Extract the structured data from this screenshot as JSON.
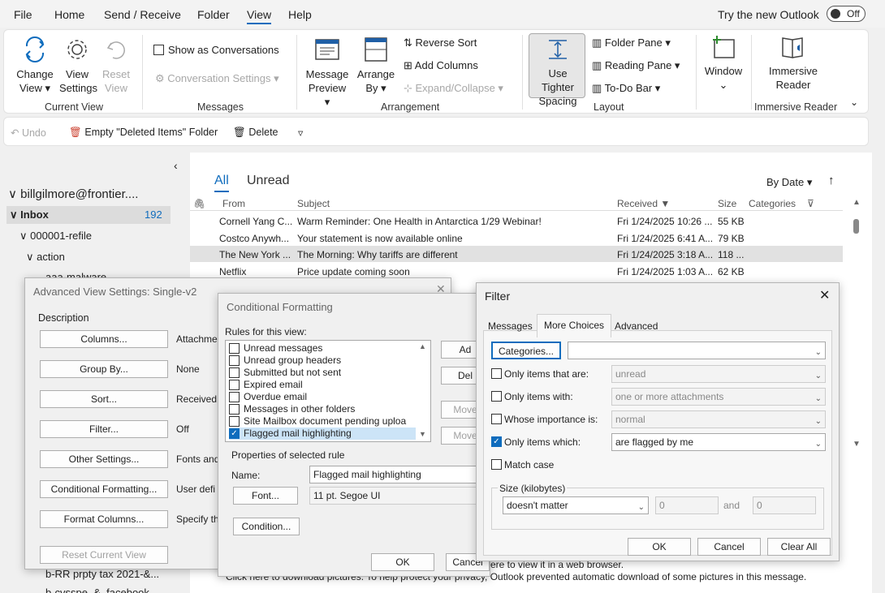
{
  "menu": {
    "items": [
      "File",
      "Home",
      "Send / Receive",
      "Folder",
      "View",
      "Help"
    ],
    "try_new": "Try the new Outlook",
    "toggle_label": "Off"
  },
  "ribbon": {
    "change_view": "Change View ▾",
    "view_settings": "View Settings",
    "reset_view": "Reset View",
    "current_view_label": "Current View",
    "show_as_conversations": "Show as Conversations",
    "conversation_settings": "Conversation Settings ▾",
    "messages_label": "Messages",
    "message_preview": "Message Preview ▾",
    "arrange_by": "Arrange By ▾",
    "reverse_sort": "Reverse Sort",
    "add_columns": "Add Columns",
    "expand_collapse": "Expand/Collapse ▾",
    "arrangement_label": "Arrangement",
    "use_tighter_spacing": "Use Tighter Spacing",
    "folder_pane": "Folder Pane ▾",
    "reading_pane": "Reading Pane ▾",
    "todo_bar": "To-Do Bar ▾",
    "layout_label": "Layout",
    "window": "Window",
    "immersive_reader": "Immersive Reader",
    "immersive_reader_label": "Immersive Reader"
  },
  "qat": {
    "undo": "Undo",
    "empty_deleted": "Empty \"Deleted Items\" Folder",
    "delete": "Delete"
  },
  "folders": {
    "account": "billgilmore@frontier....",
    "inbox": "Inbox",
    "inbox_count": "192",
    "refile": "000001-refile",
    "action": "action",
    "aaa_malware": "aaa-malware",
    "bottom1": "b-RR prpty tax 2021-&...",
    "bottom2": "b-cvsspe_&_facebook"
  },
  "list": {
    "tab_all": "All",
    "tab_unread": "Unread",
    "sort": "By Date ▾",
    "columns": [
      "From",
      "Subject",
      "Received ▼",
      "Size",
      "Categories"
    ],
    "rows": [
      {
        "from": "Cornell Yang C...",
        "subject": "Warm Reminder: One Health in Antarctica 1/29 Webinar!",
        "received": "Fri 1/24/2025 10:26 ...",
        "size": "55 KB"
      },
      {
        "from": "Costco Anywh...",
        "subject": "Your statement is now available online",
        "received": "Fri 1/24/2025 6:41 A...",
        "size": "79 KB"
      },
      {
        "from": "The New York ...",
        "subject": "The Morning: Why tariffs are different",
        "received": "Fri 1/24/2025 3:18 A...",
        "size": "118 ..."
      },
      {
        "from": "Netflix",
        "subject": "Price update coming soon",
        "received": "Fri 1/24/2025 1:03 A...",
        "size": "62 KB"
      }
    ],
    "reading_line1": "ere to view it in a web browser.",
    "reading_line2": "Click here to download pictures. To help protect your privacy, Outlook prevented automatic download of some pictures in this message."
  },
  "adv": {
    "title": "Advanced View Settings: Single-v2",
    "description": "Description",
    "buttons": [
      "Columns...",
      "Group By...",
      "Sort...",
      "Filter...",
      "Other Settings...",
      "Conditional Formatting...",
      "Format Columns..."
    ],
    "values": [
      "Attachme",
      "None",
      "Received",
      "Off",
      "Fonts and",
      "User defi",
      "Specify th"
    ],
    "reset": "Reset Current View"
  },
  "cf": {
    "title": "Conditional Formatting",
    "rules_label": "Rules for this view:",
    "rules": [
      {
        "label": "Unread messages",
        "checked": false
      },
      {
        "label": "Unread group headers",
        "checked": false
      },
      {
        "label": "Submitted but not sent",
        "checked": false
      },
      {
        "label": "Expired email",
        "checked": false
      },
      {
        "label": "Overdue email",
        "checked": false
      },
      {
        "label": "Messages in other folders",
        "checked": false
      },
      {
        "label": "Site Mailbox document pending uploa",
        "checked": false
      },
      {
        "label": "Flagged mail highlighting",
        "checked": true
      }
    ],
    "side_buttons": [
      "Ad",
      "Del",
      "Move",
      "Move"
    ],
    "props_label": "Properties of selected rule",
    "name_label": "Name:",
    "name_value": "Flagged mail highlighting",
    "font_btn": "Font...",
    "font_value": "11 pt. Segoe UI",
    "condition_btn": "Condition...",
    "ok": "OK",
    "cancel": "Cancel"
  },
  "filter": {
    "title": "Filter",
    "tabs": [
      "Messages",
      "More Choices",
      "Advanced"
    ],
    "categories_btn": "Categories...",
    "rows": [
      {
        "label": "Only items that are:",
        "value": "unread",
        "checked": false
      },
      {
        "label": "Only items with:",
        "value": "one or more attachments",
        "checked": false
      },
      {
        "label": "Whose importance is:",
        "value": "normal",
        "checked": false
      },
      {
        "label": "Only items which:",
        "value": "are flagged by me",
        "checked": true
      }
    ],
    "match_case": "Match case",
    "size_label": "Size (kilobytes)",
    "size_option": "doesn't matter",
    "size_from": "0",
    "and": "and",
    "size_to": "0",
    "ok": "OK",
    "cancel": "Cancel",
    "clear_all": "Clear All"
  }
}
